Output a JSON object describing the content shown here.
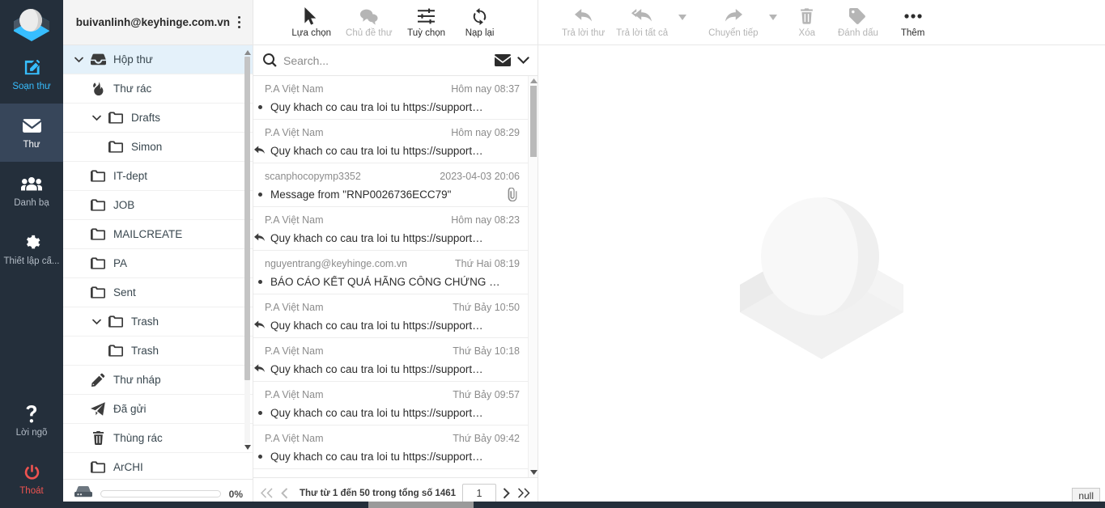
{
  "taskbar": {
    "logo_name": "roundcube-elastic-logo",
    "items": [
      {
        "label": "Soạn thư",
        "icon": "compose-icon",
        "state": "compose"
      },
      {
        "label": "Thư",
        "icon": "mail-icon",
        "state": "active"
      },
      {
        "label": "Danh bạ",
        "icon": "contacts-icon",
        "state": "normal"
      },
      {
        "label": "Thiết lập cấ...",
        "icon": "gear-icon",
        "state": "normal"
      }
    ],
    "bottom_items": [
      {
        "label": "Lời ngõ",
        "icon": "question-mark-icon",
        "state": "normal"
      },
      {
        "label": "Thoát",
        "icon": "power-icon",
        "state": "logout"
      }
    ]
  },
  "sidebar": {
    "account": "buivanlinh@keyhinge.com.vn",
    "options_icon": "kebab-menu-icon",
    "folders": [
      {
        "name": "Hộp thư",
        "icon": "inbox-icon",
        "level": 0,
        "twisty": "down",
        "selected": true
      },
      {
        "name": "Thư rác",
        "icon": "junk-icon",
        "level": 1,
        "twisty": "",
        "selected": false
      },
      {
        "name": "Drafts",
        "icon": "folder-icon",
        "level": 1,
        "twisty": "down",
        "selected": false
      },
      {
        "name": "Simon",
        "icon": "folder-icon",
        "level": 2,
        "twisty": "",
        "selected": false
      },
      {
        "name": "IT-dept",
        "icon": "folder-icon",
        "level": 1,
        "twisty": "",
        "selected": false
      },
      {
        "name": "JOB",
        "icon": "folder-icon",
        "level": 1,
        "twisty": "",
        "selected": false
      },
      {
        "name": "MAILCREATE",
        "icon": "folder-icon",
        "level": 1,
        "twisty": "",
        "selected": false
      },
      {
        "name": "PA",
        "icon": "folder-icon",
        "level": 1,
        "twisty": "",
        "selected": false
      },
      {
        "name": "Sent",
        "icon": "folder-icon",
        "level": 1,
        "twisty": "",
        "selected": false
      },
      {
        "name": "Trash",
        "icon": "folder-icon",
        "level": 1,
        "twisty": "down",
        "selected": false
      },
      {
        "name": "Trash",
        "icon": "folder-icon",
        "level": 2,
        "twisty": "",
        "selected": false
      },
      {
        "name": "Thư nháp",
        "icon": "pencil-icon",
        "level": 1,
        "twisty": "",
        "selected": false
      },
      {
        "name": "Đã gửi",
        "icon": "send-icon",
        "level": 1,
        "twisty": "",
        "selected": false
      },
      {
        "name": "Thùng rác",
        "icon": "trash-icon",
        "level": 1,
        "twisty": "",
        "selected": false
      },
      {
        "name": "ArCHI",
        "icon": "folder-icon",
        "level": 1,
        "twisty": "",
        "selected": false
      }
    ],
    "quota": {
      "icon": "disk-icon",
      "percent_label": "0%",
      "percent_value": 0
    }
  },
  "list_toolbar": {
    "buttons": [
      {
        "label": "Lựa chọn",
        "icon": "cursor-icon",
        "disabled": false
      },
      {
        "label": "Chủ đề thư",
        "icon": "threads-icon",
        "disabled": true
      },
      {
        "label": "Tuỳ chọn",
        "icon": "sliders-icon",
        "disabled": false
      },
      {
        "label": "Nạp lại",
        "icon": "refresh-icon",
        "disabled": false
      }
    ]
  },
  "search": {
    "placeholder": "Search...",
    "value": "",
    "search_icon": "search-icon",
    "scope_icon": "envelope-icon",
    "expand_icon": "chevron-down-icon"
  },
  "messages": [
    {
      "from": "P.A Việt Nam",
      "date": "Hôm nay 08:37",
      "subject": "Quy khach co cau tra loi tu https://support…",
      "flag": "unread",
      "attachment": false
    },
    {
      "from": "P.A Việt Nam",
      "date": "Hôm nay 08:29",
      "subject": "Quy khach co cau tra loi tu https://support…",
      "flag": "replied",
      "attachment": false
    },
    {
      "from": "scanphocopymp3352",
      "date": "2023-04-03 20:06",
      "subject": "Message from \"RNP0026736ECC79\"",
      "flag": "unread",
      "attachment": true
    },
    {
      "from": "P.A Việt Nam",
      "date": "Hôm nay 08:23",
      "subject": "Quy khach co cau tra loi tu https://support…",
      "flag": "replied",
      "attachment": false
    },
    {
      "from": "nguyentrang@keyhinge.com.vn",
      "date": "Thứ Hai 08:19",
      "subject": "BÁO CÁO KẾT QUẢ HÃNG CÔNG CHỨNG …",
      "flag": "unread",
      "attachment": false
    },
    {
      "from": "P.A Việt Nam",
      "date": "Thứ Bảy 10:50",
      "subject": "Quy khach co cau tra loi tu https://support…",
      "flag": "replied",
      "attachment": false
    },
    {
      "from": "P.A Việt Nam",
      "date": "Thứ Bảy 10:18",
      "subject": "Quy khach co cau tra loi tu https://support…",
      "flag": "replied",
      "attachment": false
    },
    {
      "from": "P.A Việt Nam",
      "date": "Thứ Bảy 09:57",
      "subject": "Quy khach co cau tra loi tu https://support…",
      "flag": "unread",
      "attachment": false
    },
    {
      "from": "P.A Việt Nam",
      "date": "Thứ Bảy 09:42",
      "subject": "Quy khach co cau tra loi tu https://support…",
      "flag": "unread",
      "attachment": false
    }
  ],
  "pager": {
    "first_icon": "double-chevron-left-icon",
    "prev_icon": "chevron-left-icon",
    "status": "Thư từ 1 đến 50 trong tổng số 1461",
    "page_value": "1",
    "next_icon": "chevron-right-icon",
    "last_icon": "double-chevron-right-icon"
  },
  "preview_toolbar": {
    "buttons": [
      {
        "label": "Trả lời thư",
        "icon": "reply-icon",
        "disabled": true,
        "caret": false
      },
      {
        "label": "Trả lời tất cả",
        "icon": "reply-all-icon",
        "disabled": true,
        "caret": true
      },
      {
        "label": "Chuyển tiếp",
        "icon": "forward-icon",
        "disabled": true,
        "caret": true
      },
      {
        "label": "Xóa",
        "icon": "trash-icon",
        "disabled": true,
        "caret": false
      },
      {
        "label": "Đánh dấu",
        "icon": "tag-icon",
        "disabled": true,
        "caret": false
      },
      {
        "label": "Thêm",
        "icon": "ellipsis-icon",
        "disabled": false,
        "caret": false
      }
    ]
  },
  "preview": {
    "watermark_icon": "roundcube-watermark-logo",
    "status_badge": "null"
  },
  "colors": {
    "taskbar_bg": "#242f3b",
    "taskbar_active": "#37465a",
    "accent": "#37beff",
    "logout": "#ef5350",
    "selected_folder": "#e4f1fa",
    "border": "#e7e7e7"
  }
}
